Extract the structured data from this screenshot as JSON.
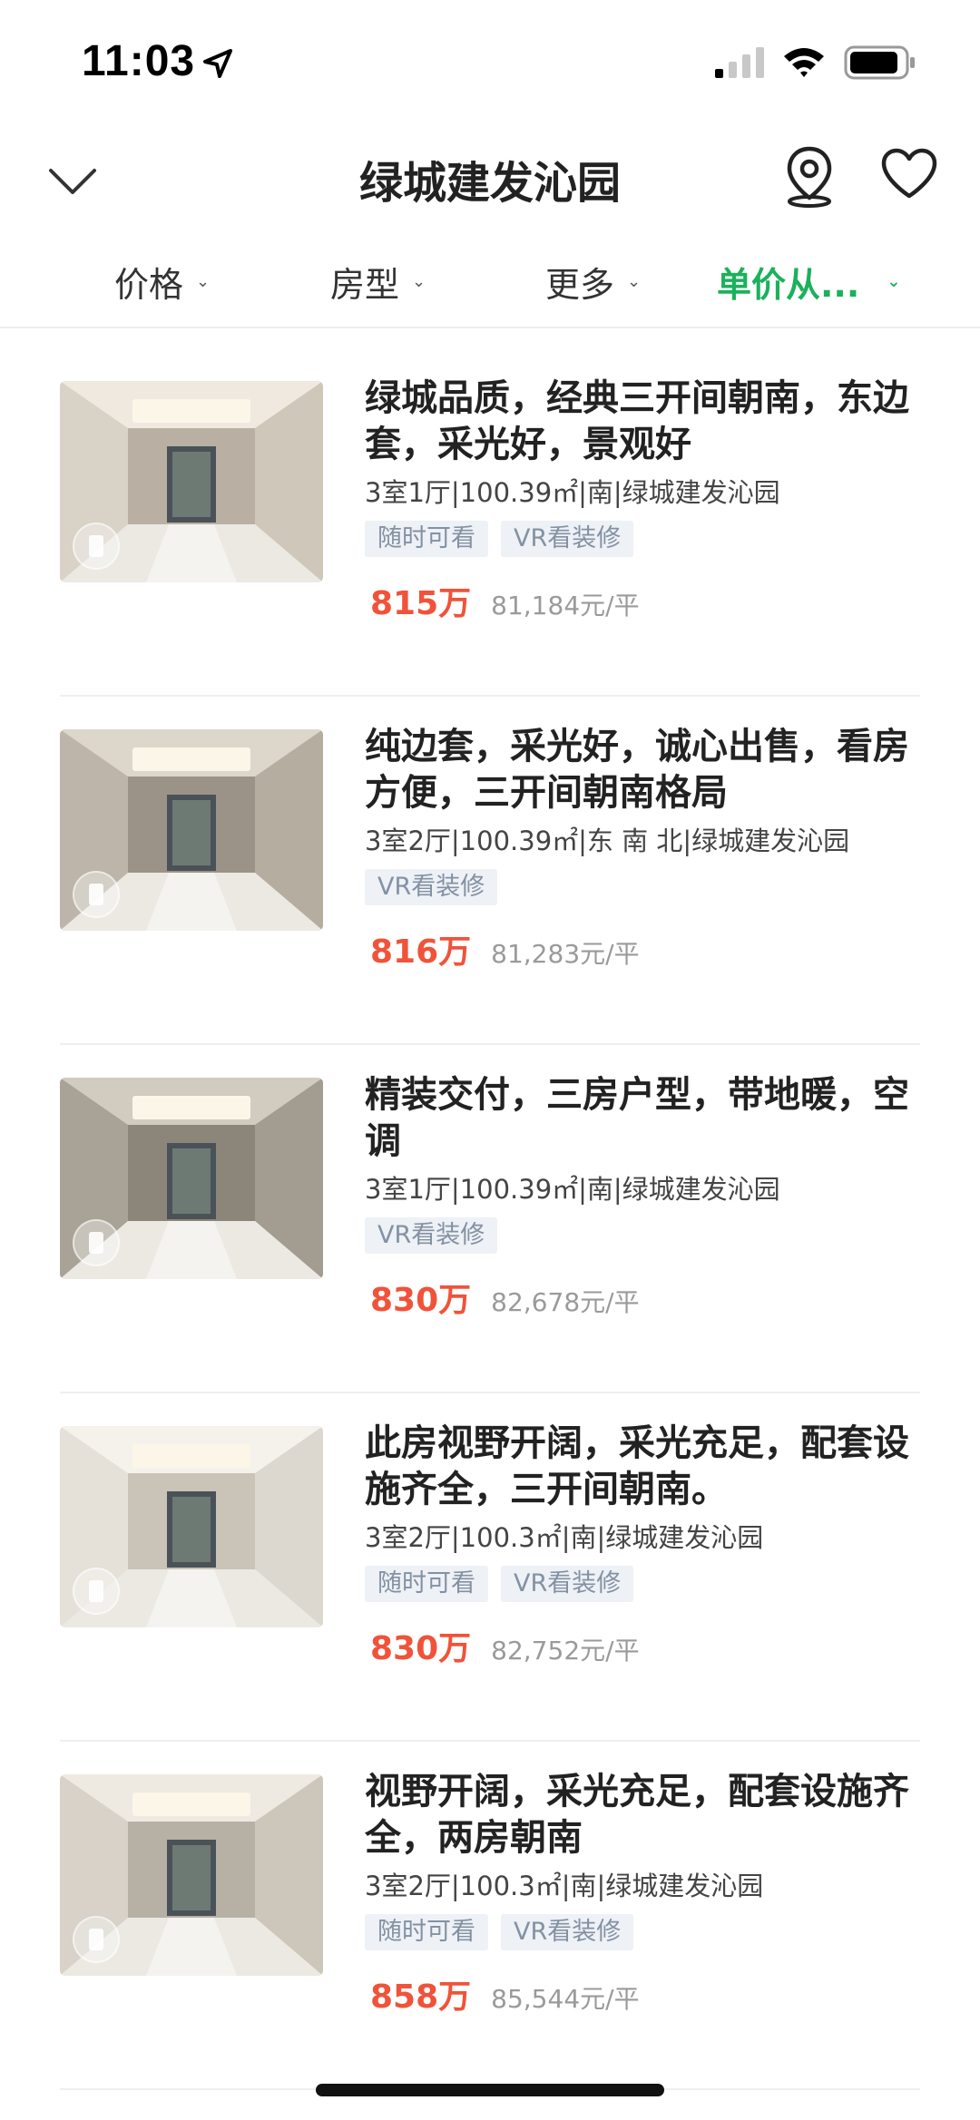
{
  "status_bar": {
    "time": "11:03"
  },
  "nav": {
    "title": "绿城建发沁园",
    "back_icon": "chevron-down-icon",
    "map_icon": "map-pin-icon",
    "fav_icon": "heart-icon"
  },
  "filters": [
    {
      "label": "价格",
      "active": false
    },
    {
      "label": "房型",
      "active": false
    },
    {
      "label": "更多",
      "active": false
    },
    {
      "label": "单价从...",
      "active": true
    }
  ],
  "colors": {
    "accent_green": "#1bb15c",
    "price_red": "#f0533a",
    "tag_bg": "#eef1f5",
    "tag_text": "#8391a4"
  },
  "listings": [
    {
      "title": "绿城品质，经典三开间朝南，东边套，采光好，景观好",
      "desc": "3室1厅|100.39㎡|南|绿城建发沁园",
      "tags": [
        "随时可看",
        "VR看装修"
      ],
      "price": "815万",
      "unit_price": "81,184元/平"
    },
    {
      "title": "纯边套，采光好，诚心出售，看房方便，三开间朝南格局",
      "desc": "3室2厅|100.39㎡|东 南 北|绿城建发沁园",
      "tags": [
        "VR看装修"
      ],
      "price": "816万",
      "unit_price": "81,283元/平"
    },
    {
      "title": "精装交付，三房户型，带地暖，空调",
      "desc": "3室1厅|100.39㎡|南|绿城建发沁园",
      "tags": [
        "VR看装修"
      ],
      "price": "830万",
      "unit_price": "82,678元/平"
    },
    {
      "title": "此房视野开阔，采光充足，配套设施齐全，三开间朝南。",
      "desc": "3室2厅|100.3㎡|南|绿城建发沁园",
      "tags": [
        "随时可看",
        "VR看装修"
      ],
      "price": "830万",
      "unit_price": "82,752元/平"
    },
    {
      "title": "视野开阔，采光充足，配套设施齐全，两房朝南",
      "desc": "3室2厅|100.3㎡|南|绿城建发沁园",
      "tags": [
        "随时可看",
        "VR看装修"
      ],
      "price": "858万",
      "unit_price": "85,544元/平"
    }
  ]
}
